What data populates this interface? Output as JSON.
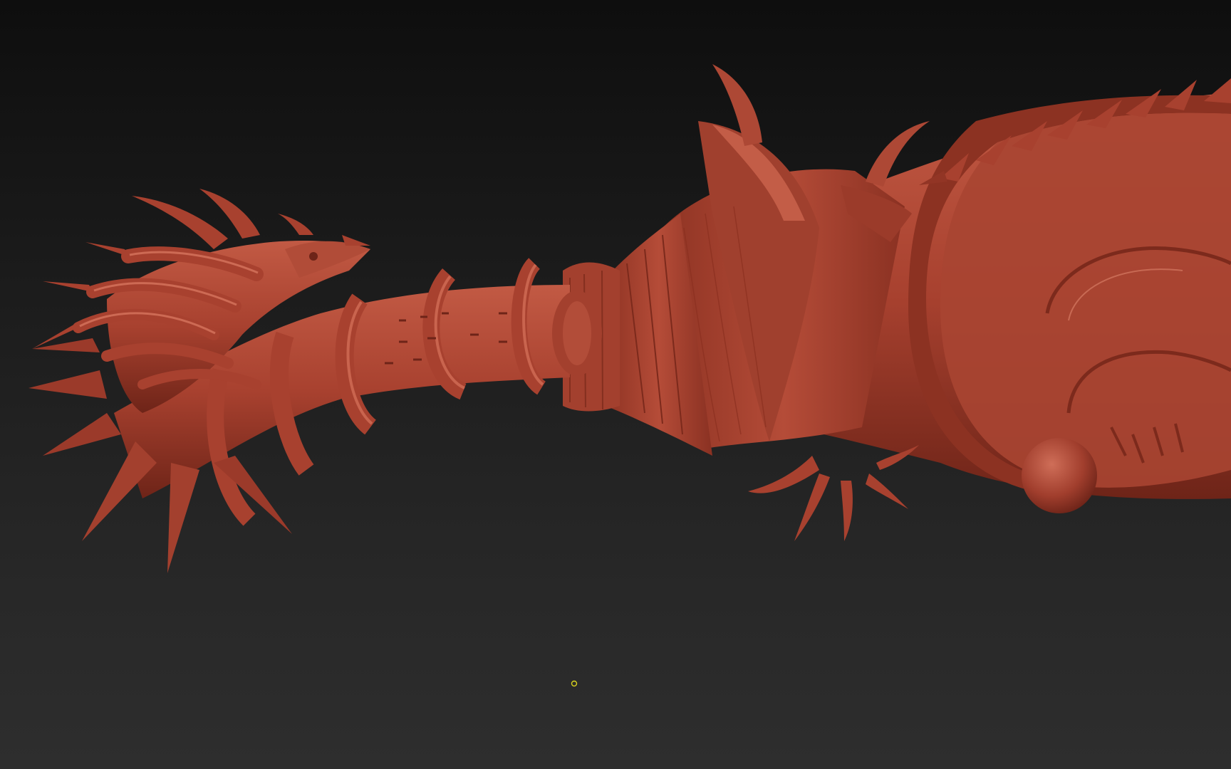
{
  "viewport": {
    "background_top": "#0e0e0e",
    "background_bottom": "#2e2e2e"
  },
  "model": {
    "material_color": "#a8412f",
    "highlight_color": "#c8634d",
    "shadow_color": "#5e1d14",
    "parts": [
      "dragon-head",
      "coiled-handle",
      "guard",
      "blade"
    ]
  },
  "cursor": {
    "icon": "brush-cursor-icon",
    "color": "#d8d21e"
  }
}
